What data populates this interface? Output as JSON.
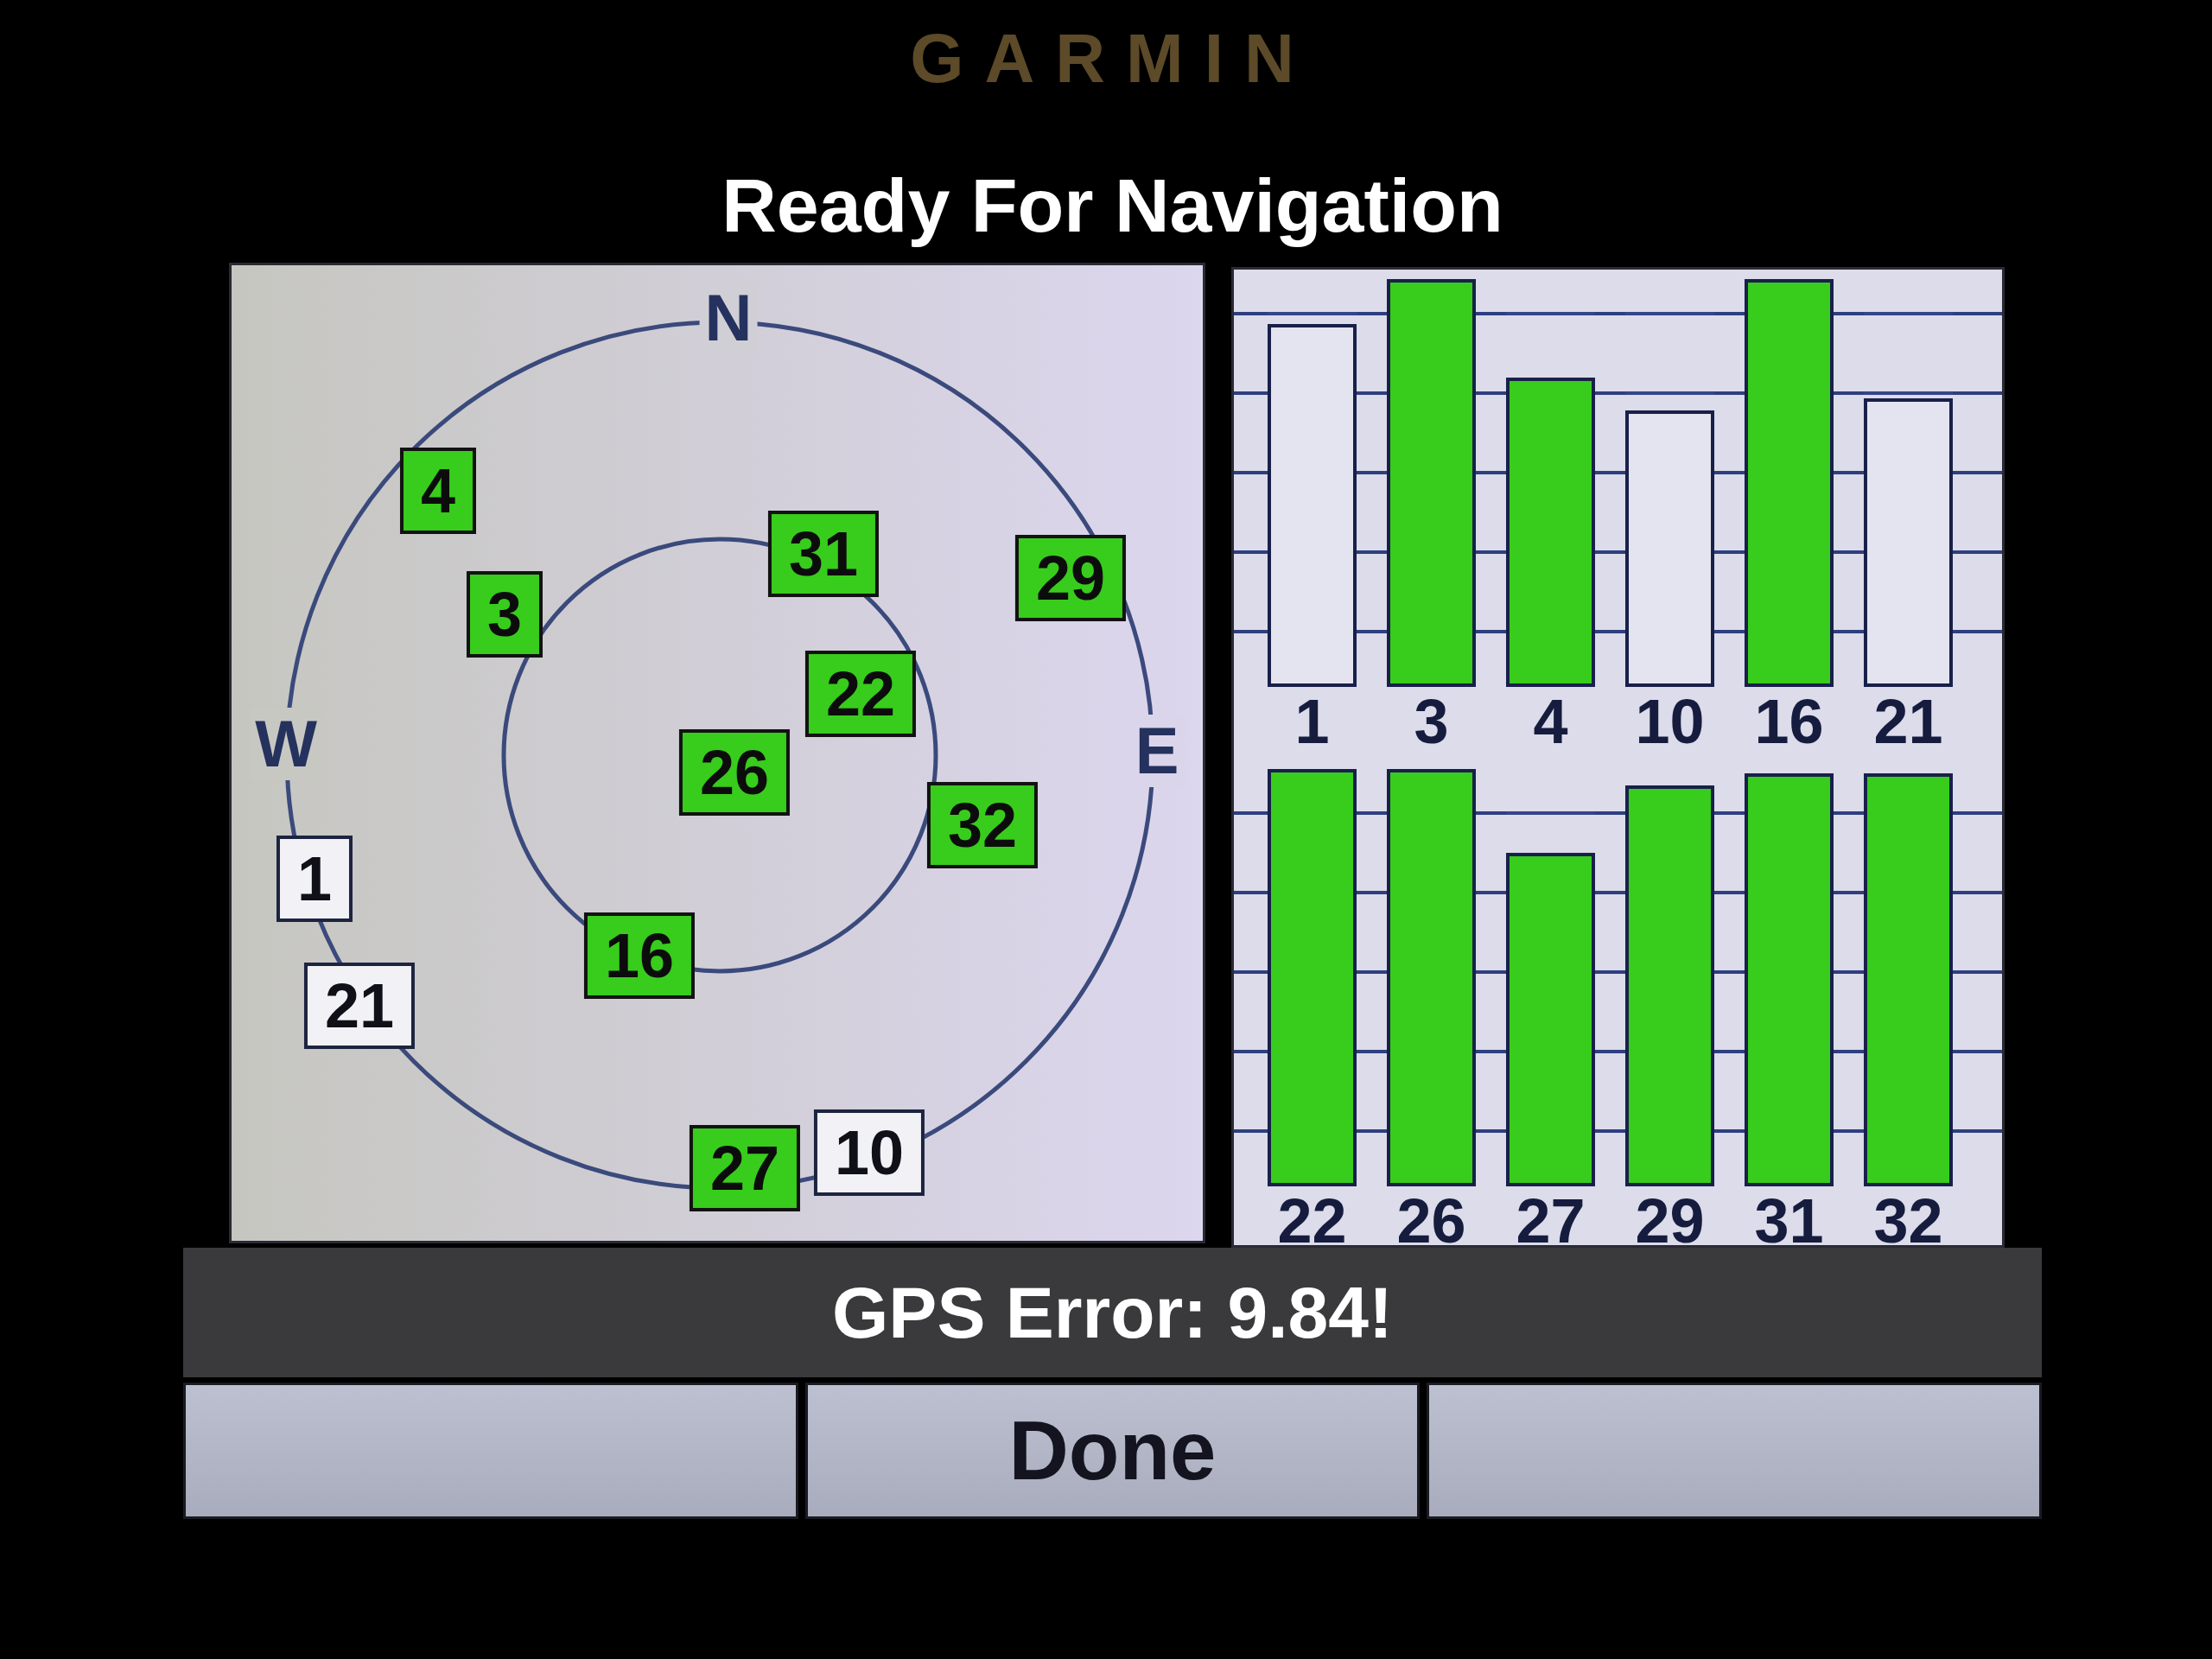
{
  "device": {
    "brand": "GARMIN"
  },
  "title": "Ready For Navigation",
  "sky_view": {
    "compass": [
      {
        "kind": "north",
        "label": "N"
      },
      {
        "kind": "west",
        "label": "W"
      },
      {
        "kind": "east",
        "label": "E"
      }
    ],
    "satellites": [
      {
        "label": "1",
        "used": false
      },
      {
        "label": "3",
        "used": true
      },
      {
        "label": "4",
        "used": true
      },
      {
        "label": "10",
        "used": false
      },
      {
        "label": "16",
        "used": true
      },
      {
        "label": "21",
        "used": false
      },
      {
        "label": "22",
        "used": true
      },
      {
        "label": "26",
        "used": true
      },
      {
        "label": "27",
        "used": true
      },
      {
        "label": "29",
        "used": true
      },
      {
        "label": "31",
        "used": true
      },
      {
        "label": "32",
        "used": true
      }
    ]
  },
  "signal_bars": [
    {
      "label": "1",
      "level": 0.88,
      "used": false
    },
    {
      "label": "3",
      "level": 0.99,
      "used": true
    },
    {
      "label": "4",
      "level": 0.75,
      "used": true
    },
    {
      "label": "10",
      "level": 0.67,
      "used": false
    },
    {
      "label": "16",
      "level": 0.99,
      "used": true
    },
    {
      "label": "21",
      "level": 0.7,
      "used": false
    },
    {
      "label": "22",
      "level": 0.99,
      "used": true
    },
    {
      "label": "26",
      "level": 0.99,
      "used": true
    },
    {
      "label": "27",
      "level": 0.79,
      "used": true
    },
    {
      "label": "29",
      "level": 0.95,
      "used": true
    },
    {
      "label": "31",
      "level": 0.98,
      "used": true
    },
    {
      "label": "32",
      "level": 0.98,
      "used": true
    }
  ],
  "status": "GPS Error: 9.84!",
  "buttons": [
    {
      "kind": "blank"
    },
    {
      "kind": "text",
      "label": "Done"
    },
    {
      "kind": "blank"
    }
  ]
}
